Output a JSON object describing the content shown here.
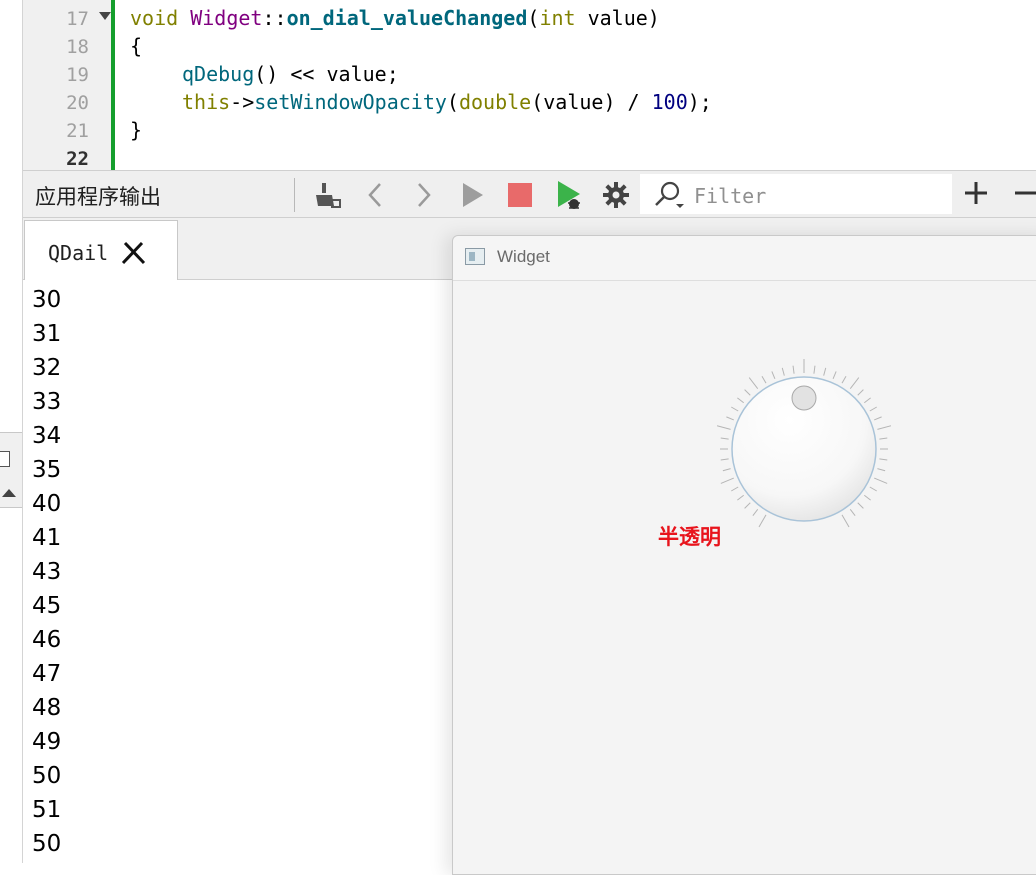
{
  "editor": {
    "lines": [
      {
        "num": "17",
        "current": false
      },
      {
        "num": "18",
        "current": false
      },
      {
        "num": "19",
        "current": false
      },
      {
        "num": "20",
        "current": false
      },
      {
        "num": "21",
        "current": false
      },
      {
        "num": "22",
        "current": true
      }
    ],
    "code": {
      "l17_kw_void": "void",
      "l17_class": "Widget",
      "l17_scope": "::",
      "l17_func": "on_dial_valueChanged",
      "l17_open": "(",
      "l17_kw_int": "int",
      "l17_param": " value)",
      "l18": "{",
      "l19_func": "qDebug",
      "l19_rest": "() << value;",
      "l20_this": "this",
      "l20_arrow": "->",
      "l20_func": "setWindowOpacity",
      "l20_open": "(",
      "l20_double": "double",
      "l20_mid": "(value) / ",
      "l20_num": "100",
      "l20_end": ");",
      "l21": "}"
    }
  },
  "toolbar": {
    "title": "应用程序输出",
    "icons": [
      "clean-icon",
      "back-icon",
      "forward-icon",
      "run-icon",
      "stop-icon",
      "debug-run-icon",
      "settings-icon"
    ],
    "filter_placeholder": "Filter",
    "plus_label": "+",
    "minus_label": "−"
  },
  "tabs": [
    {
      "label": "QDail"
    }
  ],
  "output": {
    "lines": [
      "30",
      "31",
      "32",
      "33",
      "34",
      "35",
      "40",
      "41",
      "43",
      "45",
      "46",
      "47",
      "48",
      "49",
      "50",
      "51",
      "50"
    ]
  },
  "widget_window": {
    "title": "Widget",
    "label": "半透明",
    "label_color": "#e8141c"
  },
  "colors": {
    "gutter_change": "#159e2c",
    "stop": "#e86a6a",
    "run_green": "#3bb34a"
  }
}
